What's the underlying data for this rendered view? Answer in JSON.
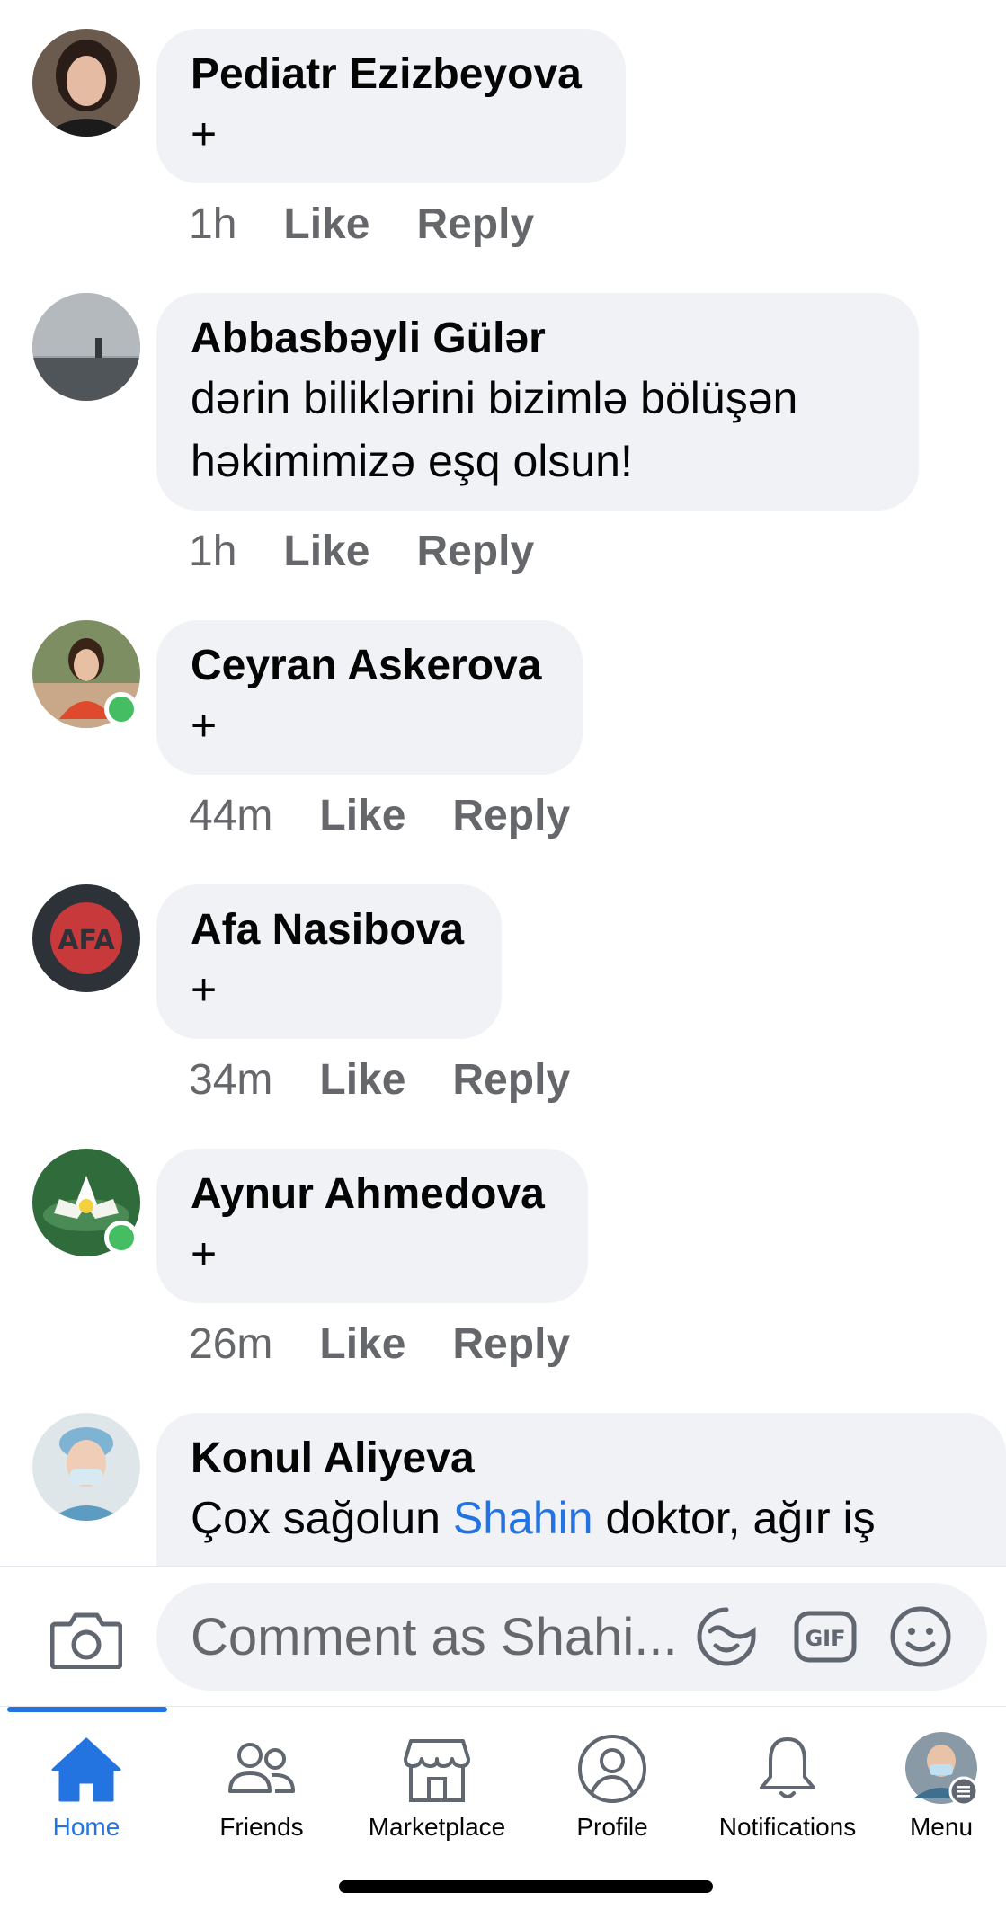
{
  "comments": [
    {
      "author": "Pediatr Ezizbeyova",
      "lines": [
        "+"
      ],
      "time": "1h",
      "like": "Like",
      "reply": "Reply",
      "online": false
    },
    {
      "author": "Abbasbəyli Gülər",
      "lines": [
        "dərin biliklərini bizimlə bölüşən",
        "həkimimizə eşq olsun!"
      ],
      "time": "1h",
      "like": "Like",
      "reply": "Reply",
      "online": false
    },
    {
      "author": "Ceyran Askerova",
      "lines": [
        "+"
      ],
      "time": "44m",
      "like": "Like",
      "reply": "Reply",
      "online": true
    },
    {
      "author": "Afa Nasibova",
      "lines": [
        "+"
      ],
      "time": "34m",
      "like": "Like",
      "reply": "Reply",
      "online": false
    },
    {
      "author": "Aynur Ahmedova",
      "lines": [
        "+"
      ],
      "time": "26m",
      "like": "Like",
      "reply": "Reply",
      "online": true
    },
    {
      "author": "Konul Aliyeva",
      "text_before": "Çox sağolun ",
      "mention": "Shahin",
      "text_after": " doktor, ağır iş",
      "online": false
    }
  ],
  "avatar_logo_text": "AFA",
  "composer": {
    "placeholder": "Comment as Shahi...",
    "icons": [
      "camera-icon",
      "sticker-icon",
      "gif-icon",
      "emoji-icon"
    ],
    "gif_label": "GIF"
  },
  "tabs": [
    {
      "label": "Home",
      "icon": "home-icon",
      "active": true
    },
    {
      "label": "Friends",
      "icon": "friends-icon",
      "active": false
    },
    {
      "label": "Marketplace",
      "icon": "marketplace-icon",
      "active": false
    },
    {
      "label": "Profile",
      "icon": "profile-icon",
      "active": false
    },
    {
      "label": "Notifications",
      "icon": "bell-icon",
      "active": false
    },
    {
      "label": "Menu",
      "icon": "menu-avatar-icon",
      "active": false
    }
  ],
  "colors": {
    "accent": "#2374e1",
    "bubble": "#f0f2f5",
    "meta": "#65676b",
    "online": "#45bd62"
  }
}
